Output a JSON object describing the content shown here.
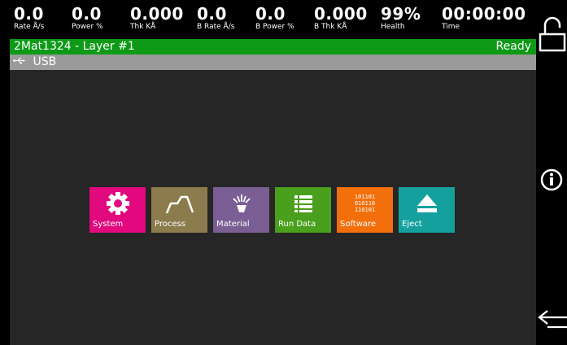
{
  "status": {
    "metrics": [
      {
        "value": "0.0",
        "label": "Rate Å/s"
      },
      {
        "value": "0.0",
        "label": "Power %"
      },
      {
        "value": "0.000",
        "label": "Thk KÅ"
      },
      {
        "value": "0.0",
        "label": "B Rate Å/s"
      },
      {
        "value": "0.0",
        "label": "B Power %"
      },
      {
        "value": "0.000",
        "label": "B Thk KÅ"
      },
      {
        "value": "99%",
        "label": "Health"
      },
      {
        "value": "00:00:00",
        "label": "Time"
      }
    ]
  },
  "layer": {
    "name": "2Mat1324 - Layer #1",
    "state": "Ready"
  },
  "device": {
    "label": "USB",
    "icon": "usb-icon"
  },
  "tiles": [
    {
      "label": "System",
      "icon": "gear-icon",
      "color": "#e2097f"
    },
    {
      "label": "Process",
      "icon": "process-graph-icon",
      "color": "#8c7b4d"
    },
    {
      "label": "Material",
      "icon": "material-source-icon",
      "color": "#7a5e94"
    },
    {
      "label": "Run Data",
      "icon": "list-icon",
      "color": "#4a9f1d"
    },
    {
      "label": "Software",
      "icon": "binary-icon",
      "color": "#f26f0c",
      "binary": [
        "101101",
        "010110",
        "110101"
      ]
    },
    {
      "label": "Eject",
      "icon": "eject-icon",
      "color": "#14a19e"
    }
  ],
  "rail": {
    "icons": [
      "lock-icon",
      "info-icon",
      "back-arrow-icon"
    ]
  }
}
